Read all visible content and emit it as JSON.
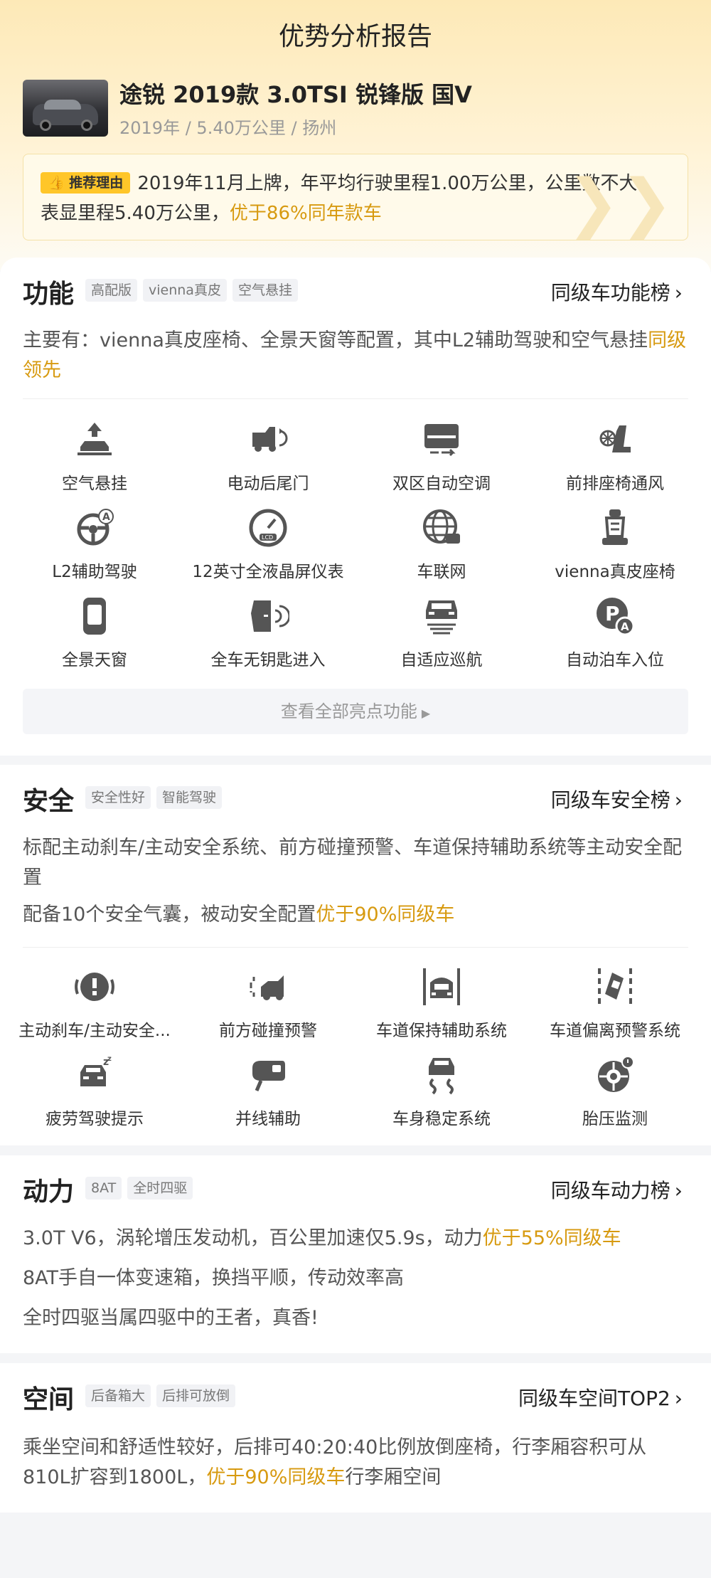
{
  "page": {
    "title": "优势分析报告"
  },
  "car": {
    "name": "途锐 2019款 3.0TSI 锐锋版 国V",
    "meta": "2019年 / 5.40万公里 / 扬州"
  },
  "reason": {
    "badge": "推荐理由",
    "text": "2019年11月上牌，年平均行驶里程1.00万公里，公里数不大，表显里程5.40万公里，",
    "highlight": "优于86%同年款车"
  },
  "function": {
    "title": "功能",
    "tags": [
      "高配版",
      "vienna真皮",
      "空气悬挂"
    ],
    "rank_link": "同级车功能榜",
    "desc": "主要有：vienna真皮座椅、全景天窗等配置，其中L2辅助驾驶和空气悬挂",
    "desc_highlight": "同级领先",
    "features": [
      {
        "label": "空气悬挂",
        "icon": "air-suspension-icon"
      },
      {
        "label": "电动后尾门",
        "icon": "power-tailgate-icon"
      },
      {
        "label": "双区自动空调",
        "icon": "dual-zone-ac-icon"
      },
      {
        "label": "前排座椅通风",
        "icon": "seat-ventilation-icon"
      },
      {
        "label": "L2辅助驾驶",
        "icon": "l2-assist-driving-icon"
      },
      {
        "label": "12英寸全液晶屏仪表",
        "icon": "lcd-instrument-icon"
      },
      {
        "label": "车联网",
        "icon": "connected-car-icon"
      },
      {
        "label": "vienna真皮座椅",
        "icon": "leather-seat-icon"
      },
      {
        "label": "全景天窗",
        "icon": "panoramic-sunroof-icon"
      },
      {
        "label": "全车无钥匙进入",
        "icon": "keyless-entry-icon"
      },
      {
        "label": "自适应巡航",
        "icon": "adaptive-cruise-icon"
      },
      {
        "label": "自动泊车入位",
        "icon": "auto-parking-icon"
      }
    ],
    "view_all": "查看全部亮点功能"
  },
  "safety": {
    "title": "安全",
    "tags": [
      "安全性好",
      "智能驾驶"
    ],
    "rank_link": "同级车安全榜",
    "desc1": "标配主动刹车/主动安全系统、前方碰撞预警、车道保持辅助系统等主动安全配置",
    "desc2": "配备10个安全气囊，被动安全配置",
    "desc2_highlight": "优于90%同级车",
    "features": [
      {
        "label": "主动刹车/主动安全...",
        "icon": "active-brake-icon"
      },
      {
        "label": "前方碰撞预警",
        "icon": "collision-warning-icon"
      },
      {
        "label": "车道保持辅助系统",
        "icon": "lane-keep-icon"
      },
      {
        "label": "车道偏离预警系统",
        "icon": "lane-departure-icon"
      },
      {
        "label": "疲劳驾驶提示",
        "icon": "fatigue-alert-icon"
      },
      {
        "label": "并线辅助",
        "icon": "blind-spot-icon"
      },
      {
        "label": "车身稳定系统",
        "icon": "stability-control-icon"
      },
      {
        "label": "胎压监测",
        "icon": "tire-pressure-icon"
      }
    ]
  },
  "power": {
    "title": "动力",
    "tags": [
      "8AT",
      "全时四驱"
    ],
    "rank_link": "同级车动力榜",
    "line1": "3.0T V6，涡轮增压发动机，百公里加速仅5.9s，动力",
    "line1_highlight": "优于55%同级车",
    "line2": "8AT手自一体变速箱，换挡平顺，传动效率高",
    "line3": "全时四驱当属四驱中的王者，真香!"
  },
  "space": {
    "title": "空间",
    "tags": [
      "后备箱大",
      "后排可放倒"
    ],
    "rank_link": "同级车空间TOP2",
    "desc": "乘坐空间和舒适性较好，后排可40:20:40比例放倒座椅，行李厢容积可从810L扩容到1800L，",
    "desc_highlight": "优于90%同级车",
    "desc_tail": "行李厢空间"
  }
}
